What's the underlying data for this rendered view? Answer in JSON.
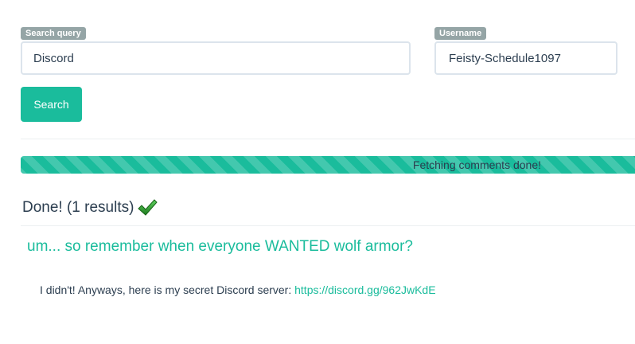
{
  "search": {
    "query_label": "Search query",
    "query_value": "Discord",
    "username_label": "Username",
    "username_value": "Feisty-Schedule1097",
    "button_label": "Search"
  },
  "progress": {
    "percent": 100,
    "text": "Fetching comments done!"
  },
  "status": {
    "text": "Done! (1 results)",
    "icon": "checkmark-icon"
  },
  "results": [
    {
      "title": "um... so remember when everyone WANTED wolf armor?",
      "body_text": "I didn't! Anyways, here is my secret Discord server: ",
      "link_text": "https://discord.gg/962JwKdE"
    }
  ],
  "colors": {
    "accent": "#1abc9c",
    "text": "#2c3e50",
    "label_bg": "#95a5a6",
    "border": "#dce4ec"
  }
}
